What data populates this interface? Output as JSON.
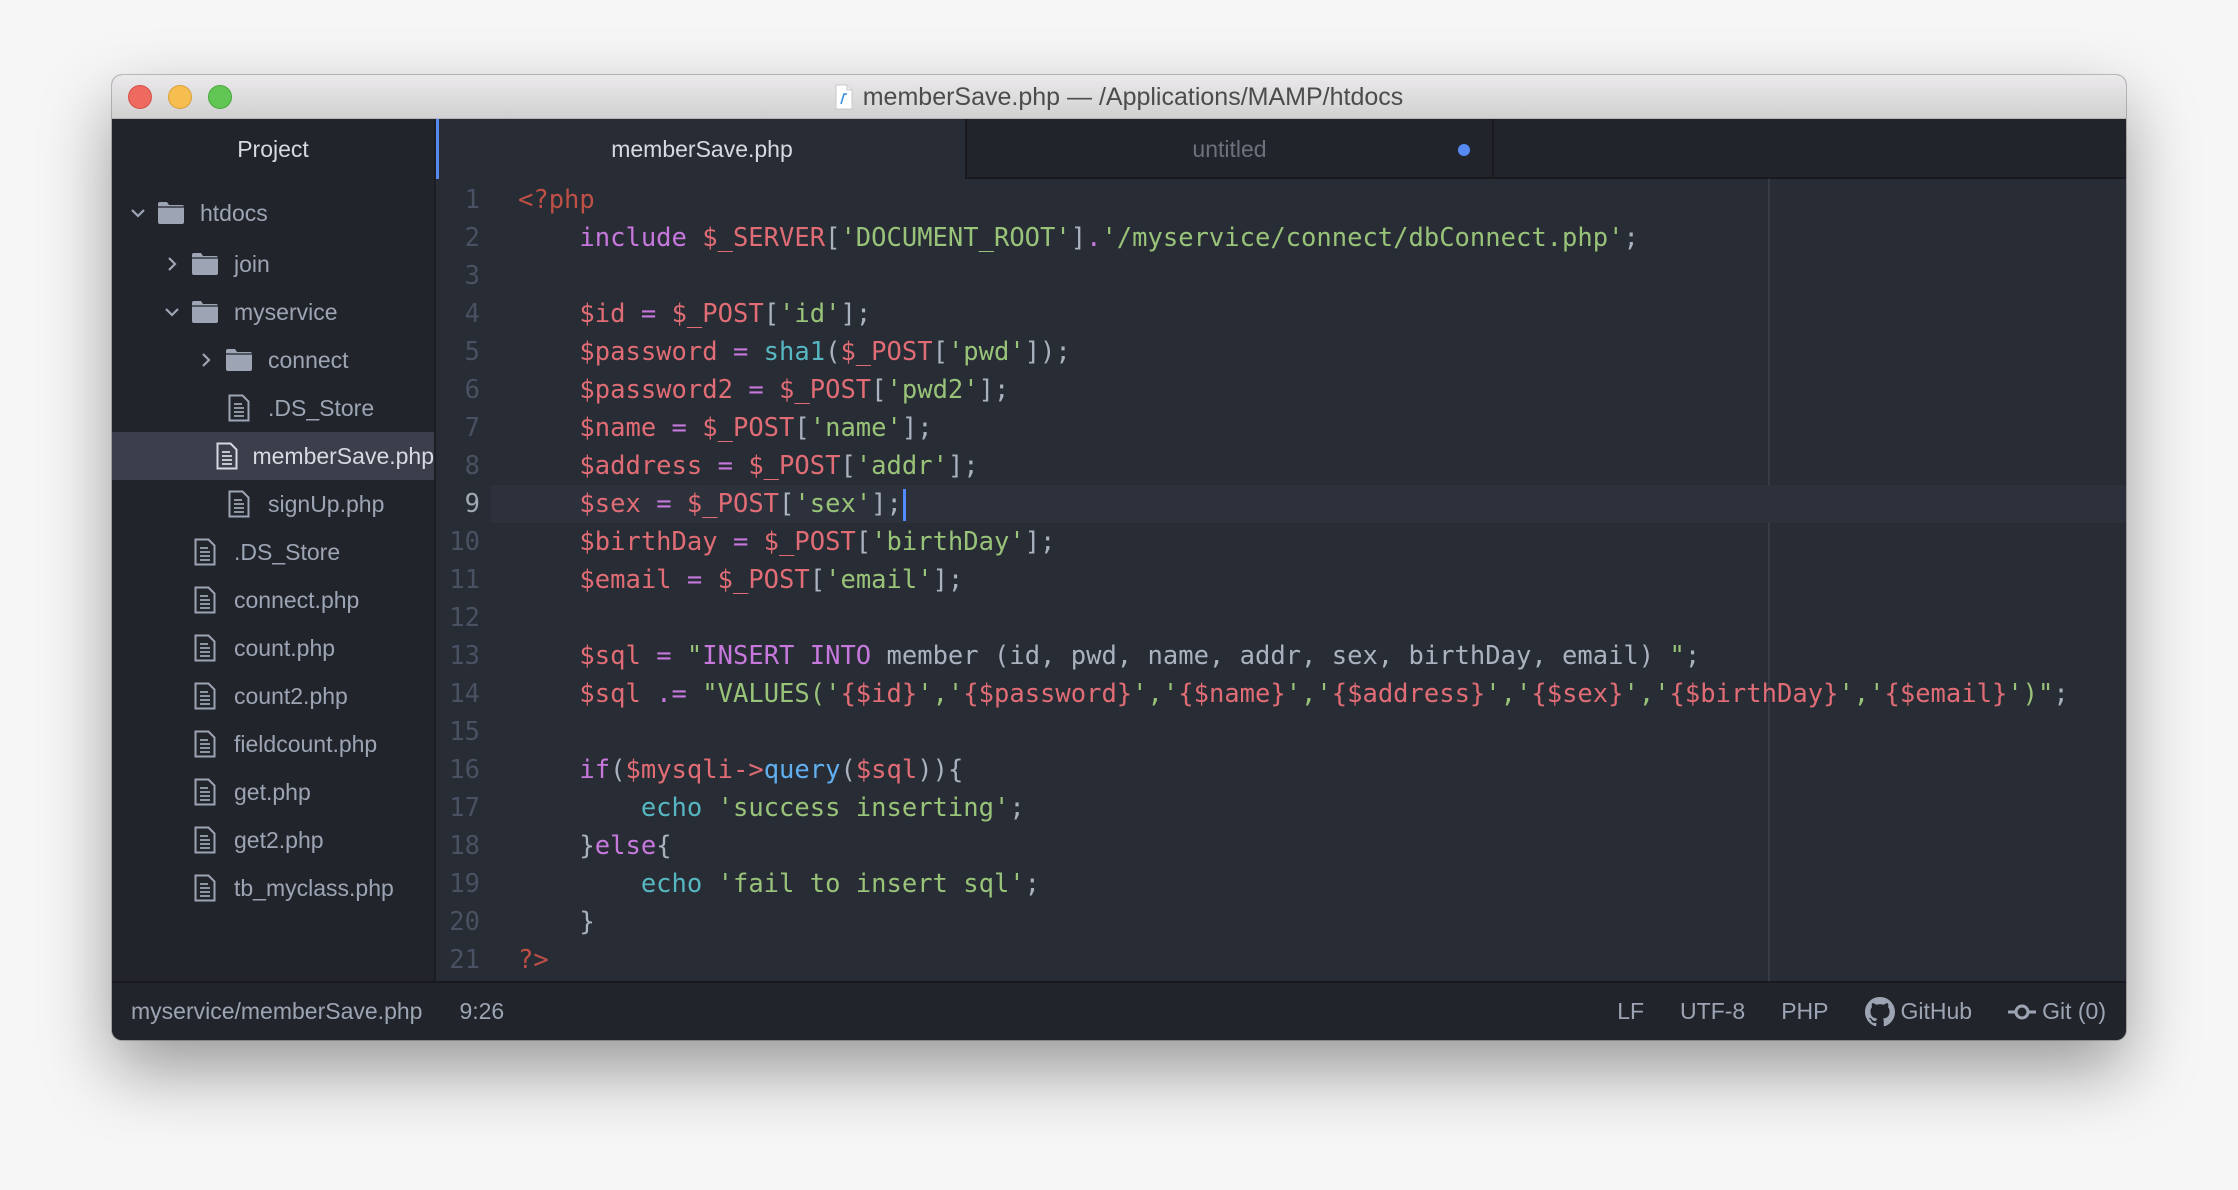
{
  "window": {
    "title": "memberSave.php — /Applications/MAMP/htdocs"
  },
  "sidebar": {
    "header": "Project",
    "tree": [
      {
        "label": "htdocs",
        "type": "folder",
        "level": 0,
        "expanded": true
      },
      {
        "label": "join",
        "type": "folder",
        "level": 1,
        "expanded": false
      },
      {
        "label": "myservice",
        "type": "folder",
        "level": 1,
        "expanded": true
      },
      {
        "label": "connect",
        "type": "folder",
        "level": 2,
        "expanded": false
      },
      {
        "label": ".DS_Store",
        "type": "file",
        "level": 2
      },
      {
        "label": "memberSave.php",
        "type": "file",
        "level": 2,
        "selected": true
      },
      {
        "label": "signUp.php",
        "type": "file",
        "level": 2
      },
      {
        "label": ".DS_Store",
        "type": "file",
        "level": 1
      },
      {
        "label": "connect.php",
        "type": "file",
        "level": 1
      },
      {
        "label": "count.php",
        "type": "file",
        "level": 1
      },
      {
        "label": "count2.php",
        "type": "file",
        "level": 1
      },
      {
        "label": "fieldcount.php",
        "type": "file",
        "level": 1
      },
      {
        "label": "get.php",
        "type": "file",
        "level": 1
      },
      {
        "label": "get2.php",
        "type": "file",
        "level": 1
      },
      {
        "label": "tb_myclass.php",
        "type": "file",
        "level": 1
      }
    ]
  },
  "tabs": [
    {
      "label": "memberSave.php",
      "active": true,
      "modified": false
    },
    {
      "label": "untitled",
      "active": false,
      "modified": true
    }
  ],
  "editor": {
    "cursor_line": 9,
    "lines": [
      [
        [
          "t-tag",
          "<?php"
        ]
      ],
      [
        [
          "t-pun",
          "    "
        ],
        [
          "t-kw",
          "include"
        ],
        [
          "t-pun",
          " "
        ],
        [
          "t-var",
          "$_SERVER"
        ],
        [
          "t-pun",
          "["
        ],
        [
          "t-str",
          "'DOCUMENT_ROOT'"
        ],
        [
          "t-pun",
          "]"
        ],
        [
          "t-op",
          "."
        ],
        [
          "t-str",
          "'/myservice/connect/dbConnect.php'"
        ],
        [
          "t-pun",
          ";"
        ]
      ],
      [],
      [
        [
          "t-pun",
          "    "
        ],
        [
          "t-var",
          "$id"
        ],
        [
          "t-pun",
          " "
        ],
        [
          "t-op",
          "="
        ],
        [
          "t-pun",
          " "
        ],
        [
          "t-var",
          "$_POST"
        ],
        [
          "t-pun",
          "["
        ],
        [
          "t-str",
          "'id'"
        ],
        [
          "t-pun",
          "];"
        ]
      ],
      [
        [
          "t-pun",
          "    "
        ],
        [
          "t-var",
          "$password"
        ],
        [
          "t-pun",
          " "
        ],
        [
          "t-op",
          "="
        ],
        [
          "t-pun",
          " "
        ],
        [
          "t-fn",
          "sha1"
        ],
        [
          "t-pun",
          "("
        ],
        [
          "t-var",
          "$_POST"
        ],
        [
          "t-pun",
          "["
        ],
        [
          "t-str",
          "'pwd'"
        ],
        [
          "t-pun",
          "]);"
        ]
      ],
      [
        [
          "t-pun",
          "    "
        ],
        [
          "t-var",
          "$password2"
        ],
        [
          "t-pun",
          " "
        ],
        [
          "t-op",
          "="
        ],
        [
          "t-pun",
          " "
        ],
        [
          "t-var",
          "$_POST"
        ],
        [
          "t-pun",
          "["
        ],
        [
          "t-str",
          "'pwd2'"
        ],
        [
          "t-pun",
          "];"
        ]
      ],
      [
        [
          "t-pun",
          "    "
        ],
        [
          "t-var",
          "$name"
        ],
        [
          "t-pun",
          " "
        ],
        [
          "t-op",
          "="
        ],
        [
          "t-pun",
          " "
        ],
        [
          "t-var",
          "$_POST"
        ],
        [
          "t-pun",
          "["
        ],
        [
          "t-str",
          "'name'"
        ],
        [
          "t-pun",
          "];"
        ]
      ],
      [
        [
          "t-pun",
          "    "
        ],
        [
          "t-var",
          "$address"
        ],
        [
          "t-pun",
          " "
        ],
        [
          "t-op",
          "="
        ],
        [
          "t-pun",
          " "
        ],
        [
          "t-var",
          "$_POST"
        ],
        [
          "t-pun",
          "["
        ],
        [
          "t-str",
          "'addr'"
        ],
        [
          "t-pun",
          "];"
        ]
      ],
      [
        [
          "t-pun",
          "    "
        ],
        [
          "t-var",
          "$sex"
        ],
        [
          "t-pun",
          " "
        ],
        [
          "t-op",
          "="
        ],
        [
          "t-pun",
          " "
        ],
        [
          "t-var",
          "$_POST"
        ],
        [
          "t-pun",
          "["
        ],
        [
          "t-str",
          "'sex'"
        ],
        [
          "t-pun",
          "];"
        ]
      ],
      [
        [
          "t-pun",
          "    "
        ],
        [
          "t-var",
          "$birthDay"
        ],
        [
          "t-pun",
          " "
        ],
        [
          "t-op",
          "="
        ],
        [
          "t-pun",
          " "
        ],
        [
          "t-var",
          "$_POST"
        ],
        [
          "t-pun",
          "["
        ],
        [
          "t-str",
          "'birthDay'"
        ],
        [
          "t-pun",
          "];"
        ]
      ],
      [
        [
          "t-pun",
          "    "
        ],
        [
          "t-var",
          "$email"
        ],
        [
          "t-pun",
          " "
        ],
        [
          "t-op",
          "="
        ],
        [
          "t-pun",
          " "
        ],
        [
          "t-var",
          "$_POST"
        ],
        [
          "t-pun",
          "["
        ],
        [
          "t-str",
          "'email'"
        ],
        [
          "t-pun",
          "];"
        ]
      ],
      [],
      [
        [
          "t-pun",
          "    "
        ],
        [
          "t-var",
          "$sql"
        ],
        [
          "t-pun",
          " "
        ],
        [
          "t-op",
          "="
        ],
        [
          "t-pun",
          " "
        ],
        [
          "t-str",
          "\""
        ],
        [
          "t-kw",
          "INSERT INTO"
        ],
        [
          "t-pun",
          " member (id, pwd, name, addr, sex, birthDay, email) "
        ],
        [
          "t-str",
          "\""
        ],
        [
          "t-pun",
          ";"
        ]
      ],
      [
        [
          "t-pun",
          "    "
        ],
        [
          "t-var",
          "$sql"
        ],
        [
          "t-pun",
          " "
        ],
        [
          "t-op",
          ".="
        ],
        [
          "t-pun",
          " "
        ],
        [
          "t-str",
          "\"VALUES('"
        ],
        [
          "t-var",
          "{$id}"
        ],
        [
          "t-str",
          "','"
        ],
        [
          "t-var",
          "{$password}"
        ],
        [
          "t-str",
          "','"
        ],
        [
          "t-var",
          "{$name}"
        ],
        [
          "t-str",
          "','"
        ],
        [
          "t-var",
          "{$address}"
        ],
        [
          "t-str",
          "','"
        ],
        [
          "t-var",
          "{$sex}"
        ],
        [
          "t-str",
          "','"
        ],
        [
          "t-var",
          "{$birthDay}"
        ],
        [
          "t-str",
          "','"
        ],
        [
          "t-var",
          "{$email}"
        ],
        [
          "t-str",
          "')\""
        ],
        [
          "t-pun",
          ";"
        ]
      ],
      [],
      [
        [
          "t-pun",
          "    "
        ],
        [
          "t-kw",
          "if"
        ],
        [
          "t-pun",
          "("
        ],
        [
          "t-var",
          "$mysqli"
        ],
        [
          "t-var",
          "->"
        ],
        [
          "t-meth",
          "query"
        ],
        [
          "t-pun",
          "("
        ],
        [
          "t-var",
          "$sql"
        ],
        [
          "t-pun",
          ")){"
        ]
      ],
      [
        [
          "t-pun",
          "        "
        ],
        [
          "t-fn",
          "echo"
        ],
        [
          "t-pun",
          " "
        ],
        [
          "t-str",
          "'success inserting'"
        ],
        [
          "t-pun",
          ";"
        ]
      ],
      [
        [
          "t-pun",
          "    }"
        ],
        [
          "t-kw",
          "else"
        ],
        [
          "t-pun",
          "{"
        ]
      ],
      [
        [
          "t-pun",
          "        "
        ],
        [
          "t-fn",
          "echo"
        ],
        [
          "t-pun",
          " "
        ],
        [
          "t-str",
          "'fail to insert sql'"
        ],
        [
          "t-pun",
          ";"
        ]
      ],
      [
        [
          "t-pun",
          "    }"
        ]
      ],
      [
        [
          "t-tag",
          "?>"
        ]
      ]
    ]
  },
  "statusbar": {
    "file_path": "myservice/memberSave.php",
    "cursor_position": "9:26",
    "line_ending": "LF",
    "encoding": "UTF-8",
    "grammar": "PHP",
    "github_label": "GitHub",
    "git_label": "Git (0)"
  },
  "colors": {
    "accent": "#568af2",
    "editor_bg": "#282c34",
    "panel_bg": "#21252b"
  }
}
